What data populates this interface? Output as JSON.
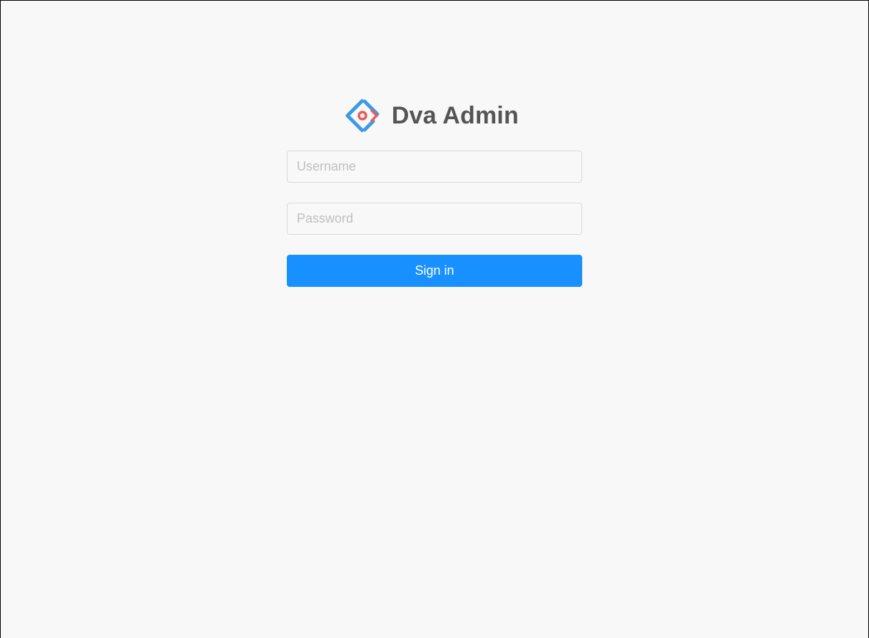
{
  "brand": {
    "title": "Dva Admin",
    "logo_icon": "dva-logo-icon"
  },
  "login_form": {
    "username": {
      "value": "",
      "placeholder": "Username"
    },
    "password": {
      "value": "",
      "placeholder": "Password"
    },
    "submit_label": "Sign in"
  },
  "colors": {
    "page_background": "#f8f8f8",
    "primary": "#1890ff",
    "logo_blue": "#3b9be5",
    "logo_red": "#ec5959",
    "title_text": "#555555",
    "placeholder_text": "#bfbfbf"
  }
}
